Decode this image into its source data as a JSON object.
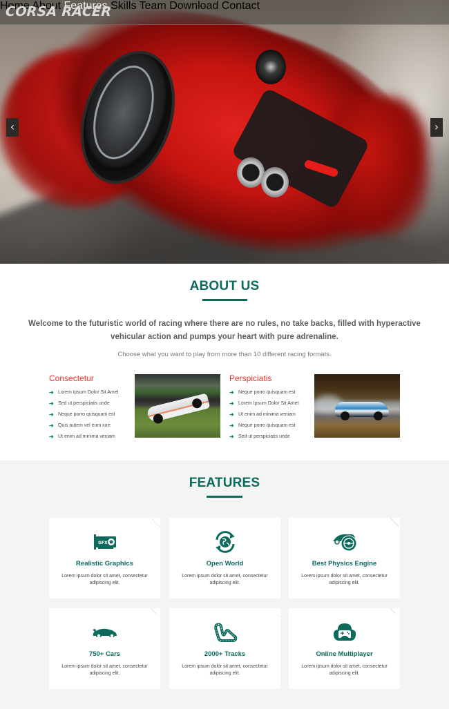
{
  "nav": {
    "logo": "CORSA RACER",
    "items": [
      "Home",
      "About",
      "Features",
      "Skills",
      "Team",
      "Download",
      "Contact"
    ],
    "active": "Features"
  },
  "hero": {
    "prev_icon": "‹",
    "next_icon": "›"
  },
  "about": {
    "title": "ABOUT US",
    "lead": "Welcome to the futuristic world of racing where there are no rules, no take backs, filled with hyperactive vehicular action and pumps your heart with pure adrenaline.",
    "sub": "Choose what you want to play from more than 10 different racing formats.",
    "columns": [
      {
        "title": "Consectetur",
        "items": [
          "Lorem Ipsum Dolor Sit Amet",
          "Sed ut perspiciatis unde",
          "Neque porro quisquam est",
          "Quis autem vel eum iure",
          "Ut enim ad minima veniam"
        ]
      },
      {
        "title": "Perspiciatis",
        "items": [
          "Neque porro quisquam est",
          "Lorem Ipsum Dolor Sit Amet",
          "Ut enim ad minima veniam",
          "Neque porro quisquam est",
          "Sed ut perspiciatis unde"
        ]
      }
    ],
    "bullet_icon": "➜"
  },
  "features": {
    "title": "FEATURES",
    "cards": [
      {
        "icon": "graphics-card-icon",
        "title": "Realistic Graphics",
        "desc": "Lorem ipsum dolor sit amet, consectetur adipiscing elit."
      },
      {
        "icon": "globe-refresh-icon",
        "title": "Open World",
        "desc": "Lorem ipsum dolor sit amet, consectetur adipiscing elit."
      },
      {
        "icon": "car-steering-wheel-icon",
        "title": "Best Physics Engine",
        "desc": "Lorem ipsum dolor sit amet, consectetur adipiscing elit."
      },
      {
        "icon": "sports-car-icon",
        "title": "750+ Cars",
        "desc": "Lorem ipsum dolor sit amet, consectetur adipiscing elit."
      },
      {
        "icon": "race-track-icon",
        "title": "2000+ Tracks",
        "desc": "Lorem ipsum dolor sit amet, consectetur adipiscing elit."
      },
      {
        "icon": "gamepad-cloud-icon",
        "title": "Online Multiplayer",
        "desc": "Lorem ipsum dolor sit amet, consectetur adipiscing elit."
      }
    ]
  },
  "colors": {
    "accent": "#0b6a5c",
    "heading_red": "#e9322e",
    "bullet": "#0e8a78"
  }
}
